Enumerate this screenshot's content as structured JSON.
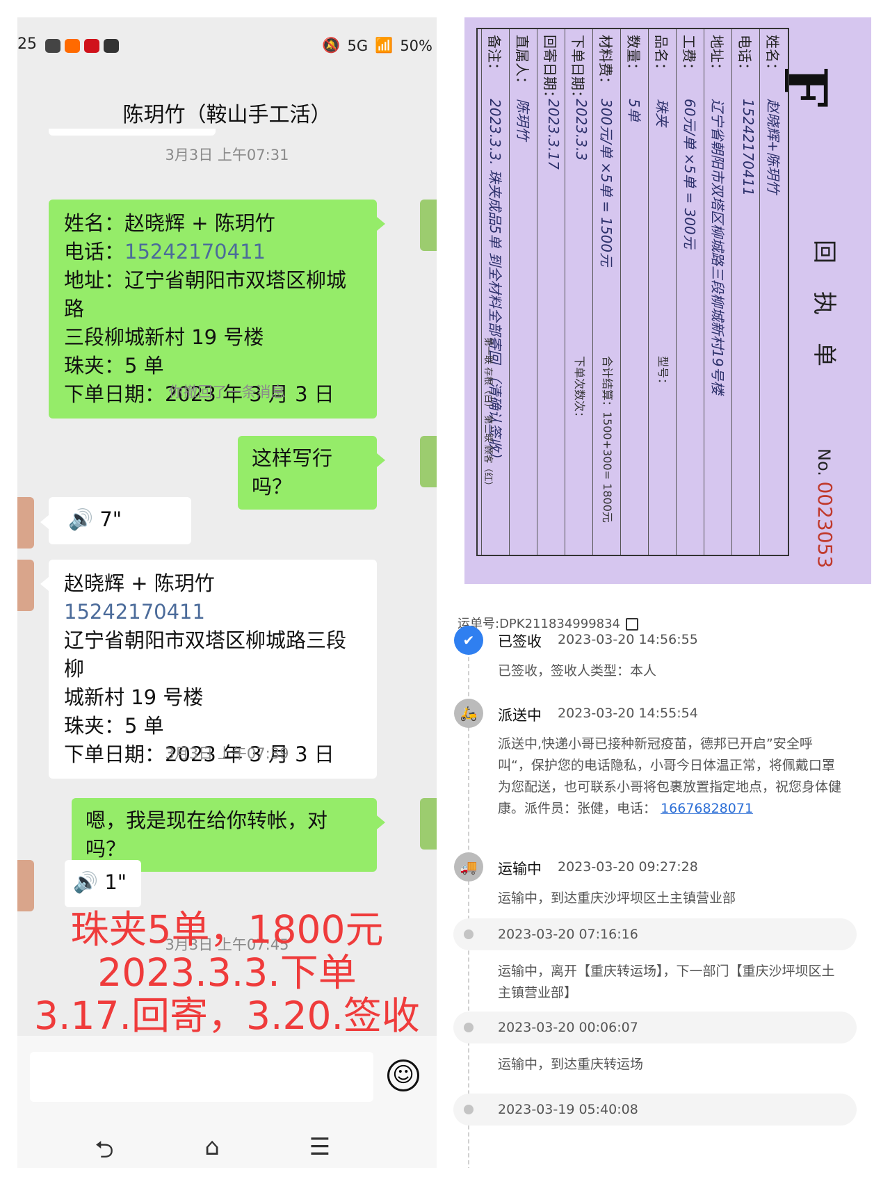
{
  "status_bar": {
    "time": "25",
    "network": "5G",
    "battery": "50%"
  },
  "chat": {
    "title": "陈玥竹（鞍山手工活）",
    "timestamp1": "3月3日 上午07:31",
    "msg1": {
      "line1": "姓名：赵晓辉 + 陈玥竹",
      "phone_prefix": "电话：",
      "phone": "15242170411",
      "line3": "地址：辽宁省朝阳市双塔区柳城路",
      "line4": "三段柳城新村 19 号楼",
      "line5": "珠夹：5 单",
      "line6": "下单日期：2023 年 3 月 3 日"
    },
    "recalled": "你撤回了一条消息",
    "msg2": "这样写行吗？",
    "voice1": "7\"",
    "msg3": {
      "line1": "赵晓辉 + 陈玥竹",
      "phone": "15242170411",
      "line3": "辽宁省朝阳市双塔区柳城路三段柳",
      "line4": "城新村 19 号楼",
      "line5": "珠夹：5 单",
      "line6": "下单日期：2023 年 3 月 3 日"
    },
    "timestamp2": "3月3日 上午07:39",
    "msg4": "嗯，我是现在给你转帐，对吗？",
    "voice2": "1\"",
    "timestamp3": "3月3日 上午07:45",
    "overlay": {
      "line1": "珠夹5单，1800元",
      "line2": "2023.3.3.下单",
      "line3": "3.17.回寄，3.20.签收"
    },
    "nav": {
      "back": "⮌",
      "home": "⌂",
      "menu": "☰"
    }
  },
  "receipt": {
    "logo": "F",
    "title": "回执单",
    "no_label": "No.",
    "no_value": "0023053",
    "rows": [
      {
        "label": "姓名：",
        "value": "赵晓辉+陈玥竹"
      },
      {
        "label": "电话：",
        "value": "15242170411"
      },
      {
        "label": "地址：",
        "value": "辽宁省朝阳市双塔区柳城路三段柳城新村19号楼"
      },
      {
        "label": "工费：",
        "value": "60元/单 ×5单 = 300元"
      },
      {
        "label": "品名：",
        "value": "珠夹",
        "extra": "型号："
      },
      {
        "label": "数量：",
        "value": "5单"
      },
      {
        "label": "材料费：",
        "value": "300元/单 ×5单 = 1500元",
        "extra": "合计结算：1500+300= 1800元"
      },
      {
        "label": "下单日期：",
        "value": "2023.3.3",
        "extra": "下单次数次："
      },
      {
        "label": "回寄日期：",
        "value": "2023.3.17"
      },
      {
        "label": "直属人：",
        "value": "陈玥竹"
      },
      {
        "label": "备注：",
        "value": "2023.3.3. 珠夹成品5单 到全材料全部寄回 （清确认签收）"
      }
    ],
    "footer": "第一联 存根（白）  第二联 顾客（红）"
  },
  "tracking": {
    "waybill": "运单号:DPK211834999834",
    "events": [
      {
        "status": "已签收",
        "time": "2023-03-20 14:56:55",
        "desc": "已签收，签收人类型：本人"
      },
      {
        "status": "派送中",
        "time": "2023-03-20 14:55:54",
        "desc": "派送中,快递小哥已接种新冠疫苗，德邦已开启”安全呼叫“，保护您的电话隐私，小哥今日体温正常，将佩戴口罩为您配送，也可联系小哥将包裹放置指定地点，祝您身体健康。派件员：张健，电话：",
        "phone": "16676828071"
      },
      {
        "status": "运输中",
        "time": "2023-03-20 09:27:28",
        "desc": "运输中，到达重庆沙坪坝区土主镇营业部"
      },
      {
        "time": "2023-03-20 07:16:16",
        "desc": "运输中，离开【重庆转运场】，下一部门【重庆沙坪坝区土主镇营业部】"
      },
      {
        "time": "2023-03-20 00:06:07",
        "desc": "运输中，到达重庆转运场"
      },
      {
        "time": "2023-03-19 05:40:08"
      }
    ]
  },
  "colors": {
    "wechat_green": "#95ec69",
    "overlay_red": "#ef3b3b",
    "link_blue": "#2d6fd6",
    "receipt_paper": "#d6c6ef"
  }
}
